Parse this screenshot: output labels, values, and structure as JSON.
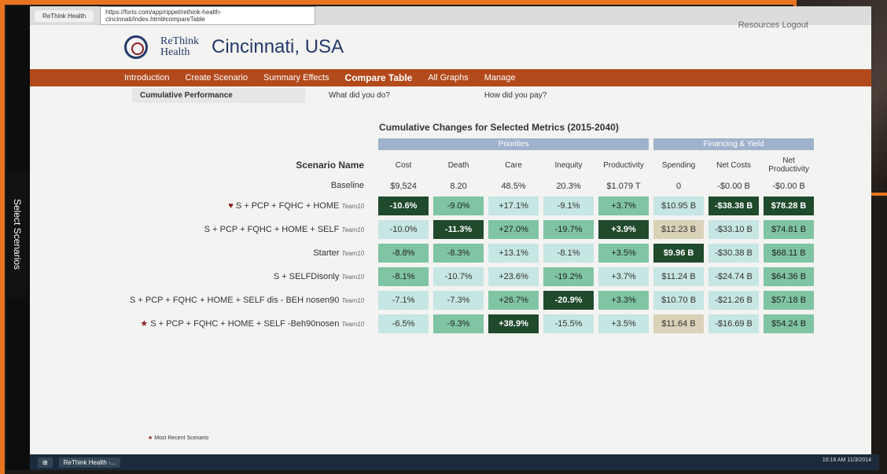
{
  "browser": {
    "tab_title": "ReThink Health",
    "url": "https://forio.com/app/rippel/rethink-health-cincinnati/index.html#compareTable"
  },
  "topnav": {
    "resources": "Resources",
    "logout": "Logout"
  },
  "header": {
    "logo_line1": "ReThink",
    "logo_line2": "Health",
    "city": "Cincinnati, USA"
  },
  "menu": [
    "Introduction",
    "Create Scenario",
    "Summary Effects",
    "Compare Table",
    "All Graphs",
    "Manage"
  ],
  "subtabs": {
    "cumulative": "Cumulative Performance",
    "what_did": "What did you do?",
    "how_pay": "How did you pay?"
  },
  "table": {
    "title": "Cumulative Changes for Selected Metrics (2015-2040)",
    "band_priorities": "Priorities",
    "band_financing": "Financing & Yield",
    "scenario_header": "Scenario Name",
    "columns": [
      "Cost",
      "Death",
      "Care",
      "Inequity",
      "Productivity",
      "Spending",
      "Net Costs",
      "Net Productivity"
    ],
    "baseline_label": "Baseline",
    "baseline_values": [
      "$9,524",
      "8.20",
      "48.5%",
      "20.3%",
      "$1.079 T",
      "0",
      "-$0.00 B",
      "-$0.00 B"
    ],
    "rows": [
      {
        "name": "S + PCP + FQHC + HOME",
        "team": "Team10",
        "marker": "heart",
        "cells": [
          "-10.6%",
          "-9.0%",
          "+17.1%",
          "-9.1%",
          "+3.7%",
          "$10.95 B",
          "-$38.38 B",
          "$78.28 B"
        ]
      },
      {
        "name": "S + PCP + FQHC + HOME + SELF",
        "team": "Team10",
        "marker": "",
        "cells": [
          "-10.0%",
          "-11.3%",
          "+27.0%",
          "-19.7%",
          "+3.9%",
          "$12.23 B",
          "-$33.10 B",
          "$74.81 B"
        ]
      },
      {
        "name": "Starter",
        "team": "Team10",
        "marker": "",
        "cells": [
          "-8.8%",
          "-8.3%",
          "+13.1%",
          "-8.1%",
          "+3.5%",
          "$9.96 B",
          "-$30.38 B",
          "$68.11 B"
        ]
      },
      {
        "name": "S + SELFDisonly",
        "team": "Team10",
        "marker": "",
        "cells": [
          "-8.1%",
          "-10.7%",
          "+23.6%",
          "-19.2%",
          "+3.7%",
          "$11.24 B",
          "-$24.74 B",
          "$64.36 B"
        ]
      },
      {
        "name": "S + PCP + FQHC + HOME + SELF dis - BEH nosen90",
        "team": "Team10",
        "marker": "",
        "cells": [
          "-7.1%",
          "-7.3%",
          "+26.7%",
          "-20.9%",
          "+3.3%",
          "$10.70 B",
          "-$21.26 B",
          "$57.18 B"
        ]
      },
      {
        "name": "S + PCP + FQHC + HOME + SELF -Beh90nosen",
        "team": "Team10",
        "marker": "star",
        "cells": [
          "-6.5%",
          "-9.3%",
          "+38.9%",
          "-15.5%",
          "+3.5%",
          "$11.64 B",
          "-$16.69 B",
          "$54.24 B"
        ]
      }
    ],
    "shades": [
      [
        "c3",
        "c2",
        "c1",
        "c1",
        "c2",
        "c1",
        "c3",
        "c3"
      ],
      [
        "c1",
        "c3",
        "c2",
        "c2",
        "c3",
        "c4",
        "c1",
        "c2"
      ],
      [
        "c2",
        "c2",
        "c1",
        "c1",
        "c2",
        "c3",
        "c1",
        "c2"
      ],
      [
        "c2",
        "c1",
        "c1",
        "c2",
        "c1",
        "c1",
        "c1",
        "c2"
      ],
      [
        "c1",
        "c1",
        "c2",
        "c3",
        "c2",
        "c1",
        "c1",
        "c2"
      ],
      [
        "c1",
        "c2",
        "c3",
        "c1",
        "c1",
        "c4",
        "c1",
        "c2"
      ]
    ]
  },
  "sidebar_button": "Select Scenarios",
  "legend": "Most Recent Scenario",
  "taskbar": {
    "app": "ReThink Health -...",
    "clock_time": "10:16 AM",
    "clock_date": "11/3/2014"
  }
}
